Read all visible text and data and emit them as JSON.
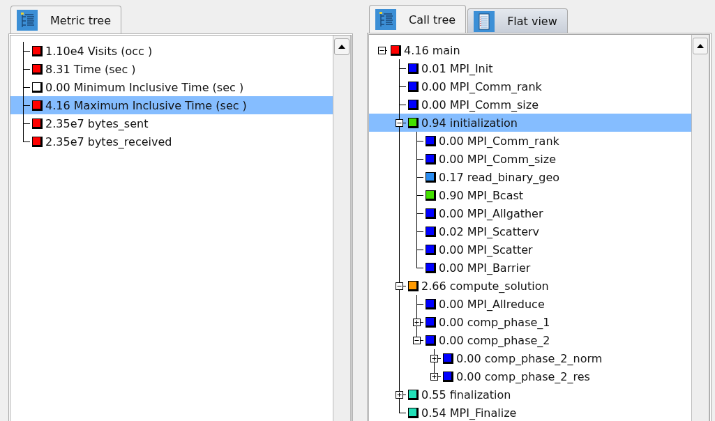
{
  "panels": [
    {
      "kind": "metric",
      "tabs": [
        {
          "label": "Metric tree",
          "kind": "tree",
          "selected": true
        }
      ],
      "tree": [
        {
          "text": "1.10e4 Visits (occ )",
          "color": "#ff0000",
          "selected": false
        },
        {
          "text": "8.31 Time (sec )",
          "color": "#ff0000",
          "selected": false
        },
        {
          "text": "0.00 Minimum Inclusive Time (sec )",
          "color": "#ffffff",
          "selected": false
        },
        {
          "text": "4.16 Maximum Inclusive Time (sec )",
          "color": "#ff0000",
          "selected": true
        },
        {
          "text": "2.35e7 bytes_sent",
          "color": "#ff0000",
          "selected": false
        },
        {
          "text": "2.35e7 bytes_received",
          "color": "#ff0000",
          "selected": false
        }
      ]
    },
    {
      "kind": "call",
      "tabs": [
        {
          "label": "Call tree",
          "kind": "tree",
          "selected": true
        },
        {
          "label": "Flat view",
          "kind": "flat",
          "selected": false
        }
      ],
      "tree": [
        {
          "text": "4.16 main",
          "color": "#ff0000",
          "selected": false,
          "expanded": true,
          "children": [
            {
              "text": "0.01 MPI_Init",
              "color": "#0000ff",
              "selected": false
            },
            {
              "text": "0.00 MPI_Comm_rank",
              "color": "#0000ff",
              "selected": false
            },
            {
              "text": "0.00 MPI_Comm_size",
              "color": "#0000ff",
              "selected": false
            },
            {
              "text": "0.94 initialization",
              "color": "#44e000",
              "selected": true,
              "expanded": true,
              "children": [
                {
                  "text": "0.00 MPI_Comm_rank",
                  "color": "#0000ff",
                  "selected": false
                },
                {
                  "text": "0.00 MPI_Comm_size",
                  "color": "#0000ff",
                  "selected": false
                },
                {
                  "text": "0.17 read_binary_geo",
                  "color": "#2a8cf0",
                  "selected": false
                },
                {
                  "text": "0.90 MPI_Bcast",
                  "color": "#44e000",
                  "selected": false
                },
                {
                  "text": "0.00 MPI_Allgather",
                  "color": "#0000ff",
                  "selected": false
                },
                {
                  "text": "0.02 MPI_Scatterv",
                  "color": "#0000ff",
                  "selected": false
                },
                {
                  "text": "0.00 MPI_Scatter",
                  "color": "#0000ff",
                  "selected": false
                },
                {
                  "text": "0.00 MPI_Barrier",
                  "color": "#0000ff",
                  "selected": false
                }
              ]
            },
            {
              "text": "2.66 compute_solution",
              "color": "#ff9a00",
              "selected": false,
              "expanded": true,
              "children": [
                {
                  "text": "0.00 MPI_Allreduce",
                  "color": "#0000ff",
                  "selected": false
                },
                {
                  "text": "0.00 comp_phase_1",
                  "color": "#0000ff",
                  "selected": false,
                  "expanded": false
                },
                {
                  "text": "0.00 comp_phase_2",
                  "color": "#0000ff",
                  "selected": false,
                  "expanded": true,
                  "children": [
                    {
                      "text": "0.00 comp_phase_2_norm",
                      "color": "#0000ff",
                      "selected": false,
                      "expanded": false
                    },
                    {
                      "text": "0.00 comp_phase_2_res",
                      "color": "#0000ff",
                      "selected": false,
                      "expanded": false
                    }
                  ]
                }
              ]
            },
            {
              "text": "0.55 finalization",
              "color": "#22e0b8",
              "selected": false,
              "expanded": false
            },
            {
              "text": "0.54 MPI_Finalize",
              "color": "#22e0b8",
              "selected": false
            }
          ]
        }
      ]
    }
  ]
}
